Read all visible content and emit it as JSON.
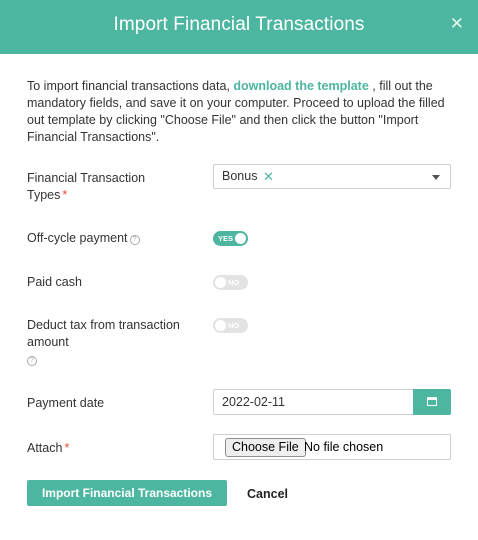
{
  "header": {
    "title": "Import Financial Transactions",
    "close_icon": "close-icon"
  },
  "intro": {
    "text_before": "To import financial transactions data, ",
    "link_text": "download the template",
    "text_after": " , fill out the mandatory fields, and save it on your computer. Proceed to upload the filled out template by clicking \"Choose File\" and then click the button \"Import Financial Transactions\"."
  },
  "fields": {
    "types": {
      "label": "Financial Transaction Types",
      "required_mark": "*",
      "selected": "Bonus",
      "remove_mark": "✕"
    },
    "off_cycle": {
      "label": "Off-cycle payment",
      "help": "?",
      "toggle_text": "YES",
      "state": "on"
    },
    "paid_cash": {
      "label": "Paid cash",
      "toggle_text": "NO",
      "state": "off"
    },
    "deduct_tax": {
      "label": "Deduct tax from transaction amount",
      "help": "?",
      "toggle_text": "NO",
      "state": "off"
    },
    "payment_date": {
      "label": "Payment date",
      "value": "2022-02-11",
      "icon": "calendar-icon"
    },
    "attach": {
      "label": "Attach",
      "required_mark": "*",
      "button": "Choose File",
      "status": "No file chosen"
    }
  },
  "actions": {
    "submit": "Import Financial Transactions",
    "cancel": "Cancel"
  },
  "colors": {
    "accent": "#4db6a0",
    "required": "#e74c3c",
    "toggle_off": "#e3e3e3"
  }
}
